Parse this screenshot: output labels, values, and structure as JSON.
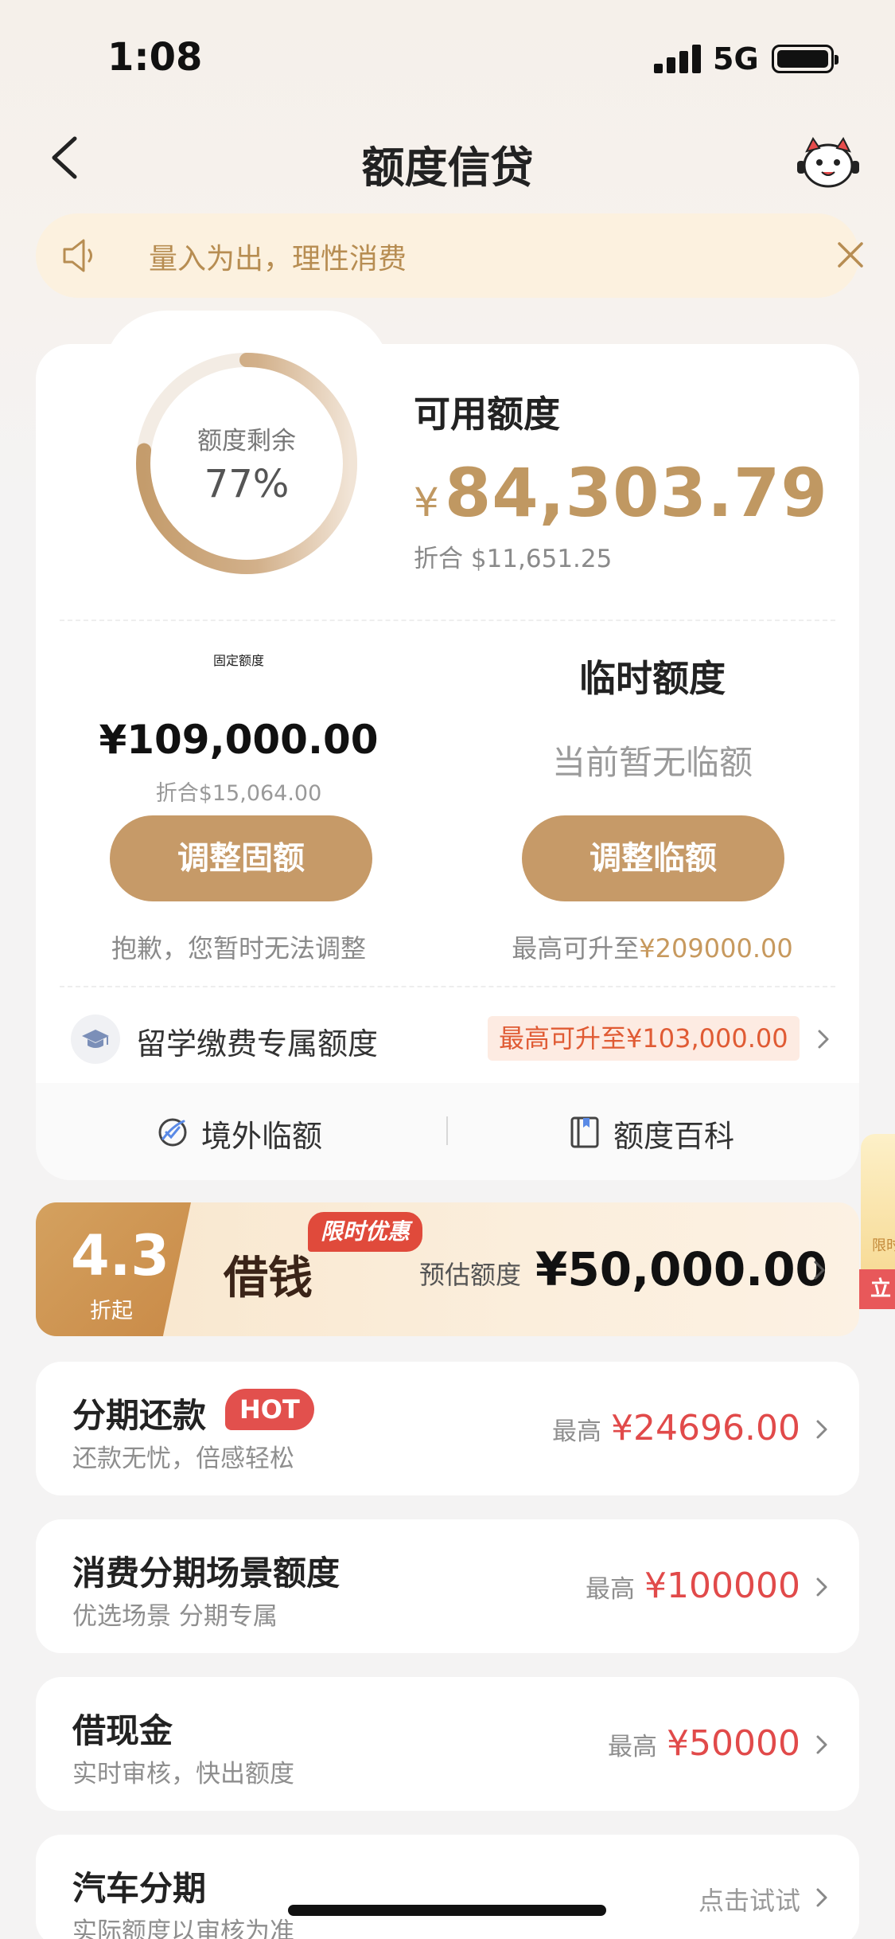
{
  "status_bar": {
    "time": "1:08",
    "network": "5G"
  },
  "header": {
    "title": "额度信贷"
  },
  "notice": {
    "text": "量入为出，理性消费"
  },
  "credit": {
    "ring_label": "额度剩余",
    "ring_percent_text": "77%",
    "remaining_fraction": 0.77,
    "available_label": "可用额度",
    "currency_symbol": "¥",
    "available_amount": "84,303.79",
    "available_usd": "折合  $11,651.25"
  },
  "fixed": {
    "title": "固定额度",
    "amount": "¥109,000.00",
    "usd": "折合$15,064.00",
    "button": "调整固额",
    "note": "抱歉，您暂时无法调整"
  },
  "temp": {
    "title": "临时额度",
    "status": "当前暂无临额",
    "button": "调整临额",
    "note_prefix": "最高可升至",
    "note_value": "¥209000.00"
  },
  "study": {
    "label": "留学缴费专属额度",
    "badge": "最高可升至¥103,000.00"
  },
  "footer_links": {
    "overseas": "境外临额",
    "wiki": "额度百科"
  },
  "side_float": {
    "tag": "限时",
    "button": "立"
  },
  "loan_banner": {
    "rate": "4.3",
    "rate_sub": "折起",
    "title": "借钱",
    "tag": "限时优惠",
    "est_label": "预估额度",
    "amount": "¥50,000.00"
  },
  "list": [
    {
      "title": "分期还款",
      "badge": "HOT",
      "subtitle": "还款无忧，倍感轻松",
      "prefix": "最高",
      "value": "¥24696.00"
    },
    {
      "title": "消费分期场景额度",
      "subtitle": "优选场景 分期专属",
      "prefix": "最高",
      "value": "¥100000"
    },
    {
      "title": "借现金",
      "subtitle": "实时审核，快出额度",
      "prefix": "最高",
      "value": "¥50000"
    },
    {
      "title": "汽车分期",
      "subtitle": "实际额度以审核为准",
      "action": "点击试试"
    }
  ],
  "colors": {
    "gold": "#c09862",
    "button_gold": "#c69a68",
    "red": "#e14a4a",
    "notice_bg": "#fcf1df"
  }
}
